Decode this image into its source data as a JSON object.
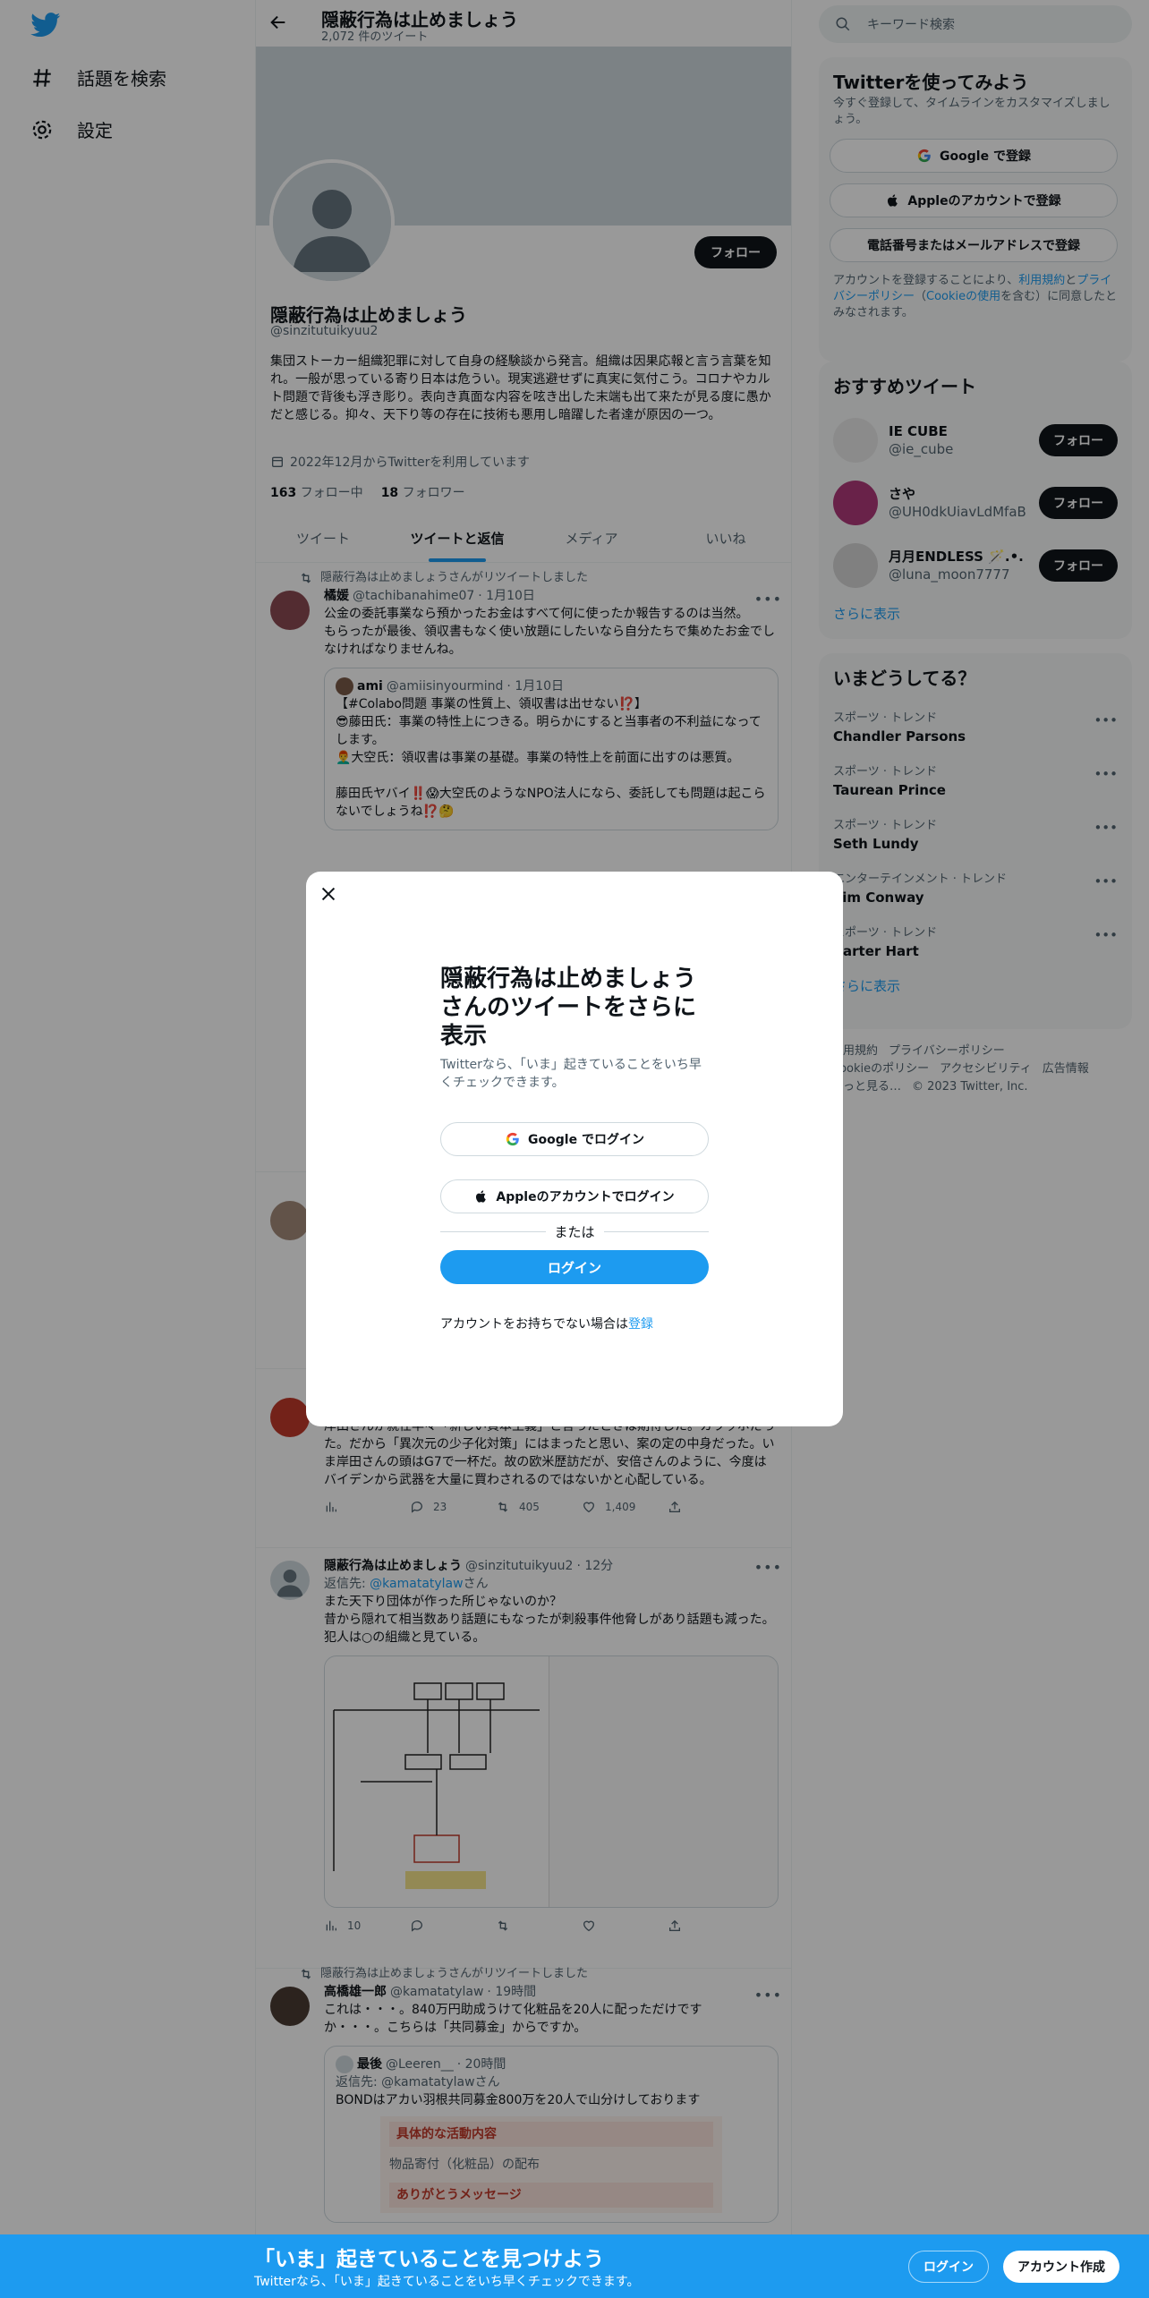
{
  "nav": {
    "explore": "話題を検索",
    "settings": "設定"
  },
  "profile": {
    "name": "隠蔽行為は止めましょう",
    "tweet_count": "2,072 件のツイート",
    "handle": "@sinzitutuikyuu2",
    "follow": "フォロー",
    "bio": "集団ストーカー組織犯罪に対して自身の経験談から発言。組織は因果応報と言う言葉を知れ。一般が思っている寄り日本は危うい。現実逃避せずに真実に気付こう。コロナやカルト問題で背後も浮き彫り。表向き真面な内容を呟き出した末端も出て来たが見る度に愚かだと感じる。抑々、天下り等の存在に技術も悪用し暗躍した者達が原因の一つ。",
    "joined": "2022年12月からTwitterを利用しています",
    "following_count": "163",
    "following_label": "フォロー中",
    "followers_count": "18",
    "followers_label": "フォロワー"
  },
  "tabs": [
    "ツイート",
    "ツイートと返信",
    "メディア",
    "いいね"
  ],
  "tweets": [
    {
      "retweeted_by": "隠蔽行為は止めましょうさんがリツイートしました",
      "author": "橘媛",
      "handle": "@tachibanahime07",
      "time": "· 1月10日",
      "text": "公金の委託事業なら預かったお金はすべて何に使ったか報告するのは当然。\nもらったが最後、領収書もなく使い放題にしたいなら自分たちで集めたお金でしなければなりませんね。",
      "quote": {
        "author": "ami",
        "handle": "@amiisinyourmind",
        "time": "· 1月10日",
        "text": "【#Colabo問題 事業の性質上、領収書は出せない⁉️】\n😎藤田氏：事業の特性上につきる。明らかにすると当事者の不利益になってします。\n👨‍🦰大空氏：領収書は事業の基礎。事業の特性上を前面に出すのは悪質。\n\n藤田氏ヤバイ‼️😱大空氏のようなNPO法人になら、委託しても問題は起こらないでしょうね⁉️🤔"
      }
    },
    {
      "text": "岸田さんが就任早々「新しい資本主義」と言ったときは期待した。カラッポだった。だから「異次元の少子化対策」にはまったと思い、案の定の中身だった。いま岸田さんの頭はG7で一杯だ。故の欧米歴訪だが、安倍さんのように、今度はバイデンから武器を大量に買わされるのではないかと心配している。",
      "replies": "23",
      "retweets": "405",
      "likes": "1,409"
    },
    {
      "author": "隠蔽行為は止めましょう",
      "handle": "@sinzitutuikyuu2",
      "time": "· 12分",
      "reply_to_prefix": "返信先: ",
      "reply_to": "@kamatatylaw",
      "reply_to_suffix": "さん",
      "text": "また天下り団体が作った所じゃないのか？\n昔から隠れて相当数あり話題にもなったが刺殺事件他脅しがあり話題も減った。犯人は○の組織と見ている。",
      "views": "10"
    },
    {
      "retweeted_by": "隠蔽行為は止めましょうさんがリツイートしました",
      "author": "高橋雄一郎",
      "handle": "@kamatatylaw",
      "time": "· 19時間",
      "text": "これは・・・。840万円助成うけて化粧品を20人に配っただけです\nか・・・。こちらは「共同募金」からですか。",
      "quote": {
        "author": "最後",
        "handle": "@Leeren__",
        "time": "· 20時間",
        "reply_prefix": "返信先: @kamatatylawさん",
        "text": "BONDはアカい羽根共同募金800万を20人で山分けしております",
        "img1": "具体的な活動内容",
        "img2": "物品寄付（化粧品）の配布",
        "img3": "ありがとうメッセージ"
      }
    }
  ],
  "right": {
    "search_placeholder": "キーワード検索",
    "onboard_title": "Twitterを使ってみよう",
    "onboard_sub": "今すぐ登録して、タイムラインをカスタマイズしましょう。",
    "google_btn": "Google で登録",
    "apple_btn": "Appleのアカウントで登録",
    "phone_btn": "電話番号またはメールアドレスで登録",
    "terms_prefix": "アカウントを登録することにより、",
    "terms_link1": "利用規約",
    "terms_and": "と",
    "terms_link2": "プライバシーポリシー",
    "terms_cookie_pre": "（",
    "terms_link3": "Cookieの使用",
    "terms_suffix": "を含む）に同意したとみなされます。",
    "rec_title": "おすすめツイート",
    "recs": [
      {
        "name": "IE CUBE",
        "handle": "@ie_cube",
        "btn": "フォロー"
      },
      {
        "name": "さや",
        "handle": "@UH0dkUiavLdMfaB",
        "btn": "フォロー"
      },
      {
        "name": "月月ENDLESS 🪄.•...",
        "handle": "@luna_moon7777",
        "btn": "フォロー"
      }
    ],
    "show_more": "さらに表示",
    "trends_title": "いまどうしてる？",
    "trends": [
      {
        "cat": "スポーツ · トレンド",
        "name": "Chandler Parsons"
      },
      {
        "cat": "スポーツ · トレンド",
        "name": "Taurean Prince"
      },
      {
        "cat": "スポーツ · トレンド",
        "name": "Seth Lundy"
      },
      {
        "cat": "エンターテインメント · トレンド",
        "name": "Tim Conway"
      },
      {
        "cat": "スポーツ · トレンド",
        "name": "Carter Hart"
      }
    ],
    "trends_more": "さらに表示",
    "footer": [
      "利用規約",
      "プライバシーポリシー",
      "Cookieのポリシー",
      "アクセシビリティ",
      "広告情報",
      "もっと見る…",
      "© 2023 Twitter, Inc."
    ]
  },
  "modal": {
    "title": "隠蔽行為は止めましょうさんのツイートをさらに表示",
    "subtitle": "Twitterなら、「いま」起きていることをいち早くチェックできます。",
    "google": "Google でログイン",
    "apple": "Appleのアカウントでログイン",
    "or": "または",
    "login": "ログイン",
    "signup_prefix": "アカウントをお持ちでない場合は",
    "signup_link": "登録"
  },
  "bottom_bar": {
    "title": "「いま」起きていることを見つけよう",
    "subtitle": "Twitterなら、「いま」起きていることをいち早くチェックできます。",
    "login": "ログイン",
    "signup": "アカウント作成"
  },
  "colors": {
    "accent": "#1d9bf0",
    "text": "#0f1419",
    "muted": "#536471"
  }
}
